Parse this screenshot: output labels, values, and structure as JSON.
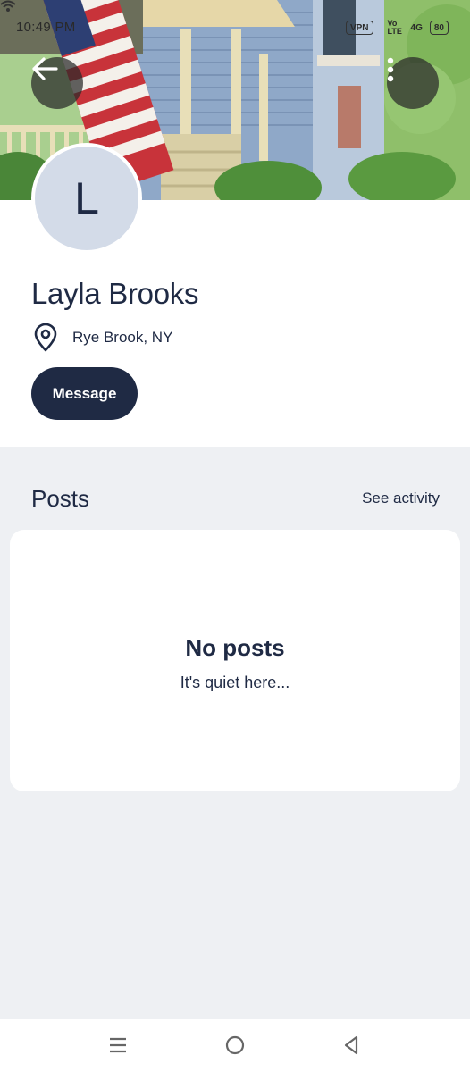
{
  "status_bar": {
    "time": "10:49 PM",
    "vpn": "VPN",
    "network": "4G",
    "volte": "Vo LTE",
    "battery": "80"
  },
  "header": {
    "back_icon": "arrow-left-icon",
    "more_icon": "vertical-ellipsis-icon"
  },
  "profile": {
    "avatar_initial": "L",
    "name": "Layla Brooks",
    "location_icon": "map-pin-icon",
    "location": "Rye Brook, NY",
    "message_label": "Message"
  },
  "posts": {
    "title": "Posts",
    "see_activity_label": "See activity",
    "empty_title": "No posts",
    "empty_subtitle": "It's quiet here..."
  },
  "nav_bar": {
    "menu_icon": "menu-icon",
    "home_icon": "home-circle-icon",
    "back_icon": "back-triangle-icon"
  },
  "colors": {
    "primary": "#1f2a44",
    "background": "#eef0f3",
    "avatar_bg": "#d3dbe8"
  }
}
